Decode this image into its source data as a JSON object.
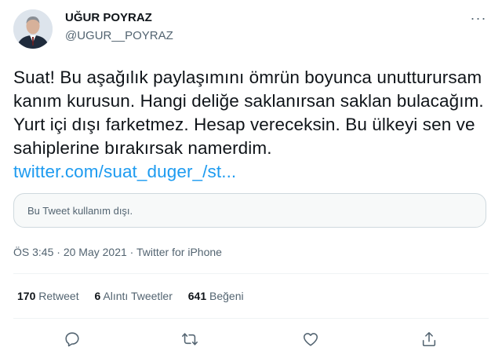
{
  "author": {
    "display_name": "UĞUR POYRAZ",
    "handle": "@UGUR__POYRAZ"
  },
  "more_button": {
    "label": "···"
  },
  "tweet": {
    "text": "Suat! Bu aşağılık paylaşımını ömrün boyunca unutturursam kanım kurusun. Hangi deliğe saklanırsan saklan bulacağım. Yurt içi dışı farketmez. Hesap vereceksin. Bu ülkeyi sen ve sahiplerine bırakırsak namerdim.",
    "link": "twitter.com/suat_duger_/st..."
  },
  "quoted_card": {
    "text": "Bu Tweet kullanım dışı."
  },
  "meta": {
    "time": "ÖS 3:45",
    "separator": "·",
    "date": "20 May 2021",
    "source": "Twitter for iPhone"
  },
  "stats": {
    "retweets_count": "170",
    "retweets_label": "Retweet",
    "quotes_count": "6",
    "quotes_label": "Alıntı Tweetler",
    "likes_count": "641",
    "likes_label": "Beğeni"
  },
  "actions": [
    "reply-icon",
    "retweet-icon",
    "like-icon",
    "share-icon"
  ],
  "colors": {
    "link": "#1d9bf0",
    "secondary_text": "#536471",
    "border": "#cfd9de"
  }
}
